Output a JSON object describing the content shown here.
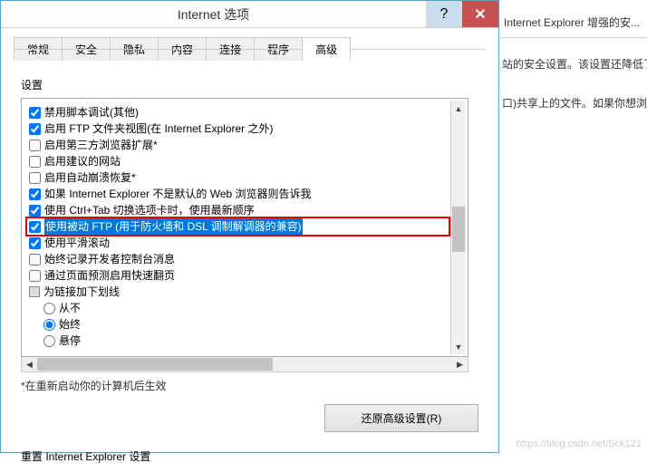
{
  "dialog": {
    "title": "Internet 选项",
    "tabs": [
      "常规",
      "安全",
      "隐私",
      "内容",
      "连接",
      "程序",
      "高级"
    ],
    "active_tab_index": 6
  },
  "settings": {
    "label": "设置",
    "items": [
      {
        "type": "checkbox",
        "checked": true,
        "label": "禁用脚本调试(其他)"
      },
      {
        "type": "checkbox",
        "checked": true,
        "label": "启用 FTP 文件夹视图(在 Internet Explorer 之外)"
      },
      {
        "type": "checkbox",
        "checked": false,
        "label": "启用第三方浏览器扩展*"
      },
      {
        "type": "checkbox",
        "checked": false,
        "label": "启用建议的网站"
      },
      {
        "type": "checkbox",
        "checked": false,
        "label": "启用自动崩溃恢复*"
      },
      {
        "type": "checkbox",
        "checked": true,
        "label": "如果 Internet Explorer 不是默认的 Web 浏览器则告诉我"
      },
      {
        "type": "checkbox",
        "checked": true,
        "label": "使用 Ctrl+Tab 切换选项卡时，使用最新顺序"
      },
      {
        "type": "checkbox",
        "checked": true,
        "label": "使用被动 FTP (用于防火墙和 DSL 调制解调器的兼容)",
        "selected": true,
        "outlined": true
      },
      {
        "type": "checkbox",
        "checked": true,
        "label": "使用平滑滚动"
      },
      {
        "type": "checkbox",
        "checked": false,
        "label": "始终记录开发者控制台消息"
      },
      {
        "type": "checkbox",
        "checked": false,
        "label": "通过页面预测启用快速翻页"
      },
      {
        "type": "node",
        "label": "为链接加下划线"
      },
      {
        "type": "radio",
        "indent": 1,
        "checked": false,
        "label": "从不"
      },
      {
        "type": "radio",
        "indent": 1,
        "checked": true,
        "label": "始终"
      },
      {
        "type": "radio",
        "indent": 1,
        "checked": false,
        "label": "悬停"
      }
    ],
    "note": "*在重新启动你的计算机后生效",
    "restore_button": "还原高级设置(R)"
  },
  "reset": {
    "label": "重置 Internet Explorer 设置"
  },
  "behind": {
    "title": "Internet Explorer 增强的安...",
    "line1": "站的安全设置。该设置还降低了你的服务",
    "line2": "口)共享上的文件。如果你想浏览一个需要使"
  },
  "watermark": "https://blog.csdn.net/Sck121"
}
